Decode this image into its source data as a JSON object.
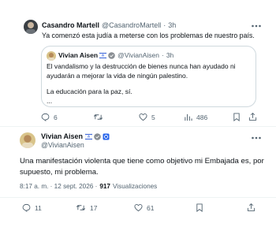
{
  "reply": {
    "name": "Casandro Martell",
    "handle": "@CasandroMartell",
    "sep": "·",
    "time": "3h",
    "text": "Ya comenzó esta judía a meterse con los problemas de nuestro país."
  },
  "quoted": {
    "name": "Vivian Aisen",
    "handle": "@VivianAisen",
    "sep": "·",
    "time": "3h",
    "line1": "El vandalismo y la destrucción de bienes nunca han ayudado ni",
    "line2": "ayudarán a mejorar la vida de ningún palestino.",
    "line3": "La educación para la paz, sí.",
    "line4": "..."
  },
  "reply_actions": {
    "replies": "6",
    "retweets": "",
    "likes": "5",
    "views": "486"
  },
  "main": {
    "name": "Vivian Aisen",
    "handle": "@VivianAisen",
    "text_line1": "Una manifestación violenta que tiene como objetivo mi Embajada es, por",
    "text_line2": "supuesto, mi problema.",
    "time": "8:17 a. m. · 12 sept. 2026 ·",
    "views_count": "917",
    "views_label": "Visualizaciones"
  },
  "main_actions": {
    "replies": "11",
    "retweets": "17",
    "likes": "61"
  },
  "colors": {
    "accent": "#1d9bf0",
    "muted": "#536471",
    "border": "#cfd9de"
  },
  "icons": [
    "more-icon",
    "reply-icon",
    "retweet-icon",
    "like-icon",
    "views-icon",
    "bookmark-icon",
    "share-icon",
    "verified-badge-icon",
    "flag-israel-icon"
  ]
}
